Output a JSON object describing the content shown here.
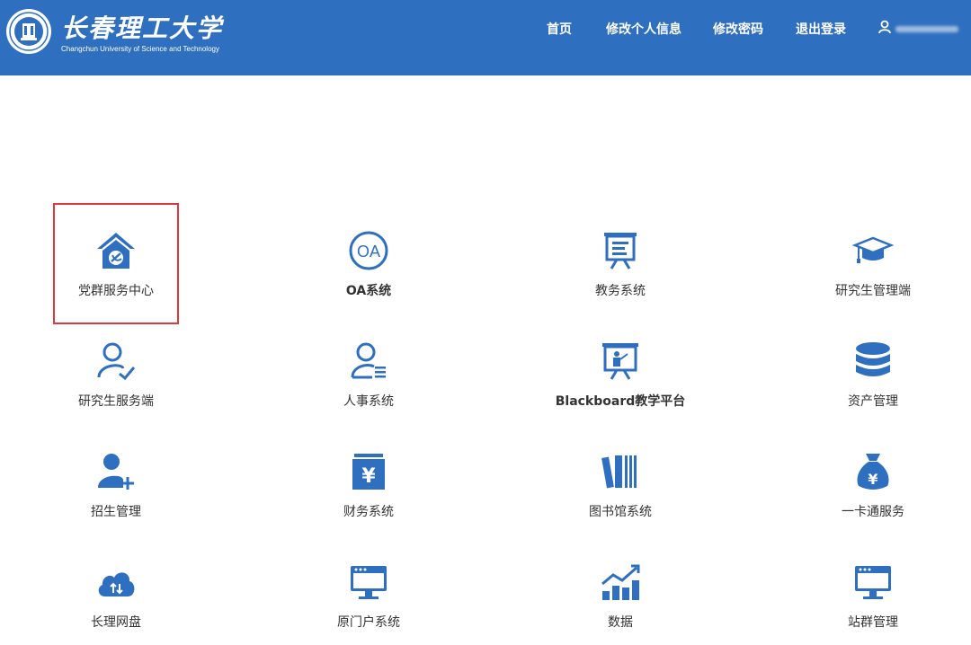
{
  "header": {
    "brand_name": "长春理工大学",
    "brand_sub": "Changchun University of Science and Technology",
    "nav": [
      {
        "label": "首页"
      },
      {
        "label": "修改个人信息"
      },
      {
        "label": "修改密码"
      },
      {
        "label": "退出登录"
      }
    ],
    "user_icon": "user-icon"
  },
  "colors": {
    "header_bg": "#2f6fbf",
    "icon_blue": "#2f6fbf",
    "highlight": "#e0383e"
  },
  "apps": [
    {
      "label": "党群服务中心",
      "icon": "party-house-icon",
      "highlighted": true
    },
    {
      "label": "OA系统",
      "icon": "oa-circle-icon"
    },
    {
      "label": "教务系统",
      "icon": "academic-board-icon"
    },
    {
      "label": "研究生管理端",
      "icon": "graduation-cap-icon"
    },
    {
      "label": "研究生服务端",
      "icon": "user-check-icon"
    },
    {
      "label": "人事系统",
      "icon": "user-list-icon"
    },
    {
      "label": "Blackboard教学平台",
      "icon": "presentation-board-icon"
    },
    {
      "label": "资产管理",
      "icon": "database-icon"
    },
    {
      "label": "招生管理",
      "icon": "user-add-icon"
    },
    {
      "label": "财务系统",
      "icon": "yuan-box-icon"
    },
    {
      "label": "图书馆系统",
      "icon": "books-icon"
    },
    {
      "label": "一卡通服务",
      "icon": "money-bag-icon"
    },
    {
      "label": "长理网盘",
      "icon": "cloud-icon"
    },
    {
      "label": "原门户系统",
      "icon": "monitor-icon"
    },
    {
      "label": "数据",
      "icon": "growth-chart-icon"
    },
    {
      "label": "站群管理",
      "icon": "monitor-icon"
    }
  ]
}
